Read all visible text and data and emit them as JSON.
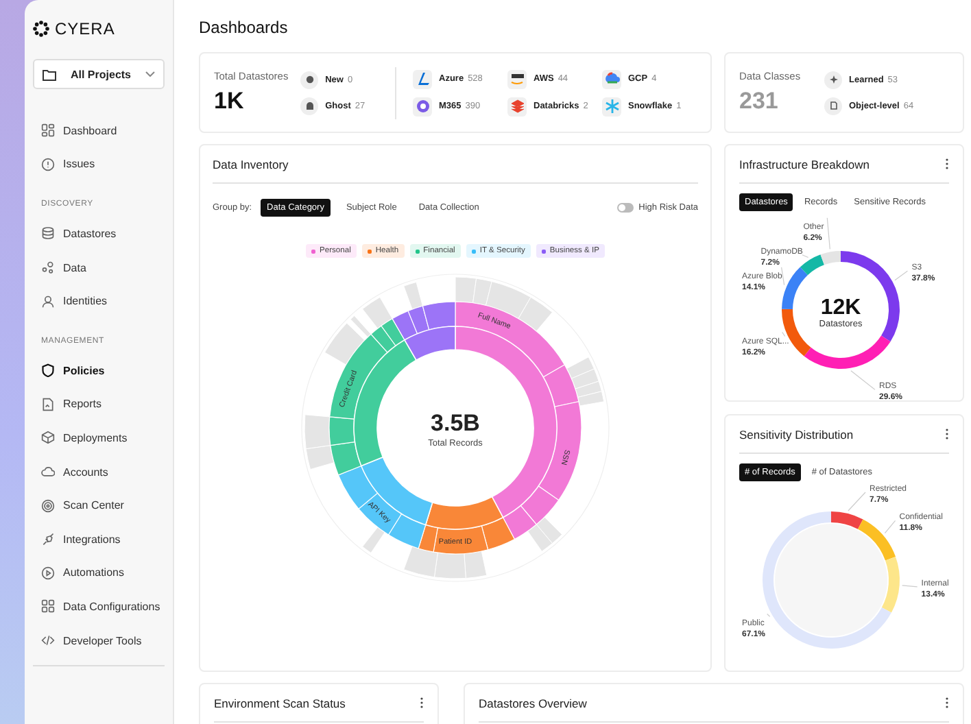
{
  "brand": {
    "name": "CYERA"
  },
  "project_selector": {
    "value": "All Projects"
  },
  "nav_sections": [
    {
      "items": [
        {
          "label": "Dashboard",
          "selected": false
        },
        {
          "label": "Issues",
          "selected": false
        }
      ]
    },
    {
      "heading": "DISCOVERY",
      "items": [
        {
          "label": "Datastores",
          "selected": false
        },
        {
          "label": "Data",
          "selected": false
        },
        {
          "label": "Identities",
          "selected": false
        }
      ]
    },
    {
      "heading": "MANAGEMENT",
      "items": [
        {
          "label": "Policies",
          "selected": true
        },
        {
          "label": "Reports",
          "selected": false
        },
        {
          "label": "Deployments",
          "selected": false
        },
        {
          "label": "Accounts",
          "selected": false
        },
        {
          "label": "Scan Center",
          "selected": false
        },
        {
          "label": "Integrations",
          "selected": false
        },
        {
          "label": "Automations",
          "selected": false
        },
        {
          "label": "Data Configurations",
          "selected": false
        },
        {
          "label": "Developer Tools",
          "selected": false
        }
      ]
    }
  ],
  "page_title": "Dashboards",
  "summary": {
    "label": "Total Datastores",
    "value": "1K",
    "statuses": [
      {
        "label": "New",
        "count": "0"
      },
      {
        "label": "Ghost",
        "count": "27"
      }
    ],
    "providers": [
      {
        "name": "Azure",
        "count": "528"
      },
      {
        "name": "AWS",
        "count": "44"
      },
      {
        "name": "GCP",
        "count": "4"
      },
      {
        "name": "M365",
        "count": "390"
      },
      {
        "name": "Databricks",
        "count": "2"
      },
      {
        "name": "Snowflake",
        "count": "1"
      }
    ]
  },
  "data_classes": {
    "label": "Data Classes",
    "value": "231",
    "items": [
      {
        "label": "Learned",
        "count": "53"
      },
      {
        "label": "Object-level",
        "count": "64"
      }
    ]
  },
  "inventory": {
    "title": "Data Inventory",
    "group_by_label": "Group by:",
    "group_options": [
      {
        "label": "Data Category",
        "selected": true
      },
      {
        "label": "Subject Role",
        "selected": false
      },
      {
        "label": "Data Collection",
        "selected": false
      }
    ],
    "toggle": {
      "label": "High Risk Data",
      "on": false
    },
    "legend": [
      {
        "label": "Personal",
        "color": "#f062d0"
      },
      {
        "label": "Health",
        "color": "#f97316"
      },
      {
        "label": "Financial",
        "color": "#22c58b"
      },
      {
        "label": "IT & Security",
        "color": "#38bdf8"
      },
      {
        "label": "Business & IP",
        "color": "#8b5cf6"
      }
    ],
    "total": "3.5B",
    "total_label": "Total Records",
    "segment_labels": [
      "Full Name",
      "SSN",
      "Patient ID",
      "API Key",
      "Credit Card"
    ]
  },
  "infrastructure": {
    "title": "Infrastructure Breakdown",
    "tabs": [
      {
        "label": "Datastores",
        "selected": true
      },
      {
        "label": "Records",
        "selected": false
      },
      {
        "label": "Sensitive Records",
        "selected": false
      }
    ],
    "center_value": "12K",
    "center_label": "Datastores",
    "chart_data": {
      "type": "donut",
      "categories": [
        "S3",
        "RDS",
        "Azure SQL...",
        "Azure Blob",
        "DynamoDB",
        "Other"
      ],
      "values": [
        37.8,
        29.6,
        16.2,
        14.1,
        7.2,
        6.2
      ],
      "value_labels": [
        "37.8%",
        "29.6%",
        "16.2%",
        "14.1%",
        "7.2%",
        "6.2%"
      ],
      "colors": [
        "#7c3aed",
        "#ff1fb4",
        "#f25a0c",
        "#3b82f6",
        "#14b8a6",
        "#e4e4e4"
      ]
    }
  },
  "sensitivity": {
    "title": "Sensitivity Distribution",
    "tabs": [
      {
        "label": "# of Records",
        "selected": true
      },
      {
        "label": "# of Datastores",
        "selected": false
      }
    ],
    "chart_data": {
      "type": "donut",
      "categories": [
        "Restricted",
        "Confidential",
        "Internal",
        "Public"
      ],
      "values": [
        7.7,
        11.8,
        13.4,
        67.1
      ],
      "value_labels": [
        "7.7%",
        "11.8%",
        "13.4%",
        "67.1%"
      ],
      "colors": [
        "#ef4444",
        "#fbbf24",
        "#fde68a",
        "#dfe6fb"
      ]
    }
  },
  "bottom_cards": [
    {
      "title": "Environment Scan Status"
    },
    {
      "title": "Datastores Overview"
    }
  ]
}
